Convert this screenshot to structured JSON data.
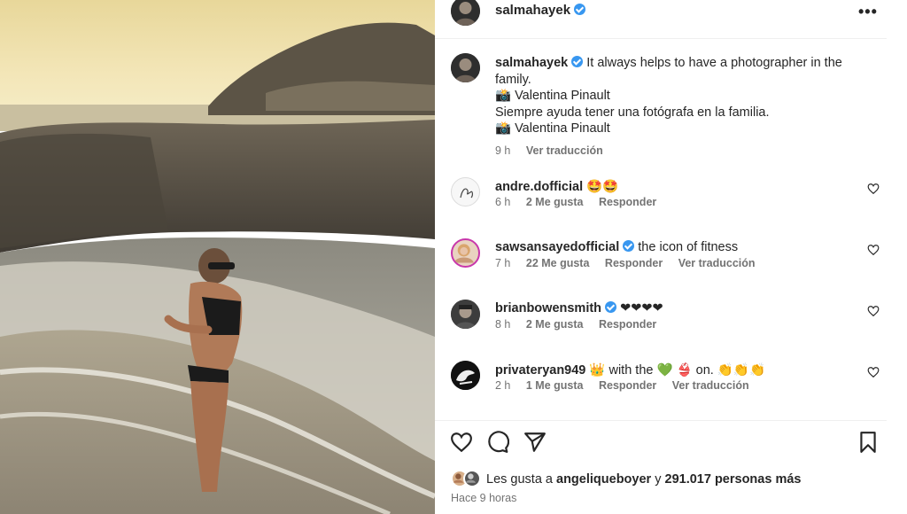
{
  "post": {
    "username": "salmahayek",
    "more_label": "•••"
  },
  "caption": {
    "username": "salmahayek",
    "line1": "It always helps to have a photographer in the family.",
    "line2": "📸 Valentina Pinault",
    "line3": "Siempre ayuda tener una fotógrafa en la familia.",
    "line4": "📸 Valentina Pinault",
    "time": "9 h",
    "translate": "Ver traducción"
  },
  "comments": [
    {
      "username": "andre.dofficial",
      "text": "🤩🤩",
      "time": "6 h",
      "likes": "2 Me gusta",
      "reply": "Responder",
      "translate": ""
    },
    {
      "username": "sawsansayedofficial",
      "text": "the icon of fitness",
      "time": "7 h",
      "likes": "22 Me gusta",
      "reply": "Responder",
      "translate": "Ver traducción"
    },
    {
      "username": "brianbowensmith",
      "text": "❤❤❤❤",
      "time": "8 h",
      "likes": "2 Me gusta",
      "reply": "Responder",
      "translate": ""
    },
    {
      "username": "privateryan949",
      "text": "👑 with the 💚 👙 on. 👏👏👏",
      "time": "2 h",
      "likes": "1 Me gusta",
      "reply": "Responder",
      "translate": "Ver traducción"
    }
  ],
  "likes": {
    "prefix": "Les gusta a",
    "user": "angeliqueboyer",
    "mid": "y",
    "count": "291.017 personas más"
  },
  "time_ago": "Hace 9 horas",
  "colors": {
    "verified": "#3897f0",
    "muted": "#737373",
    "text": "#262626"
  },
  "icons": [
    "heart-icon",
    "comment-icon",
    "share-icon",
    "bookmark-icon",
    "verified-badge-icon",
    "more-icon"
  ]
}
